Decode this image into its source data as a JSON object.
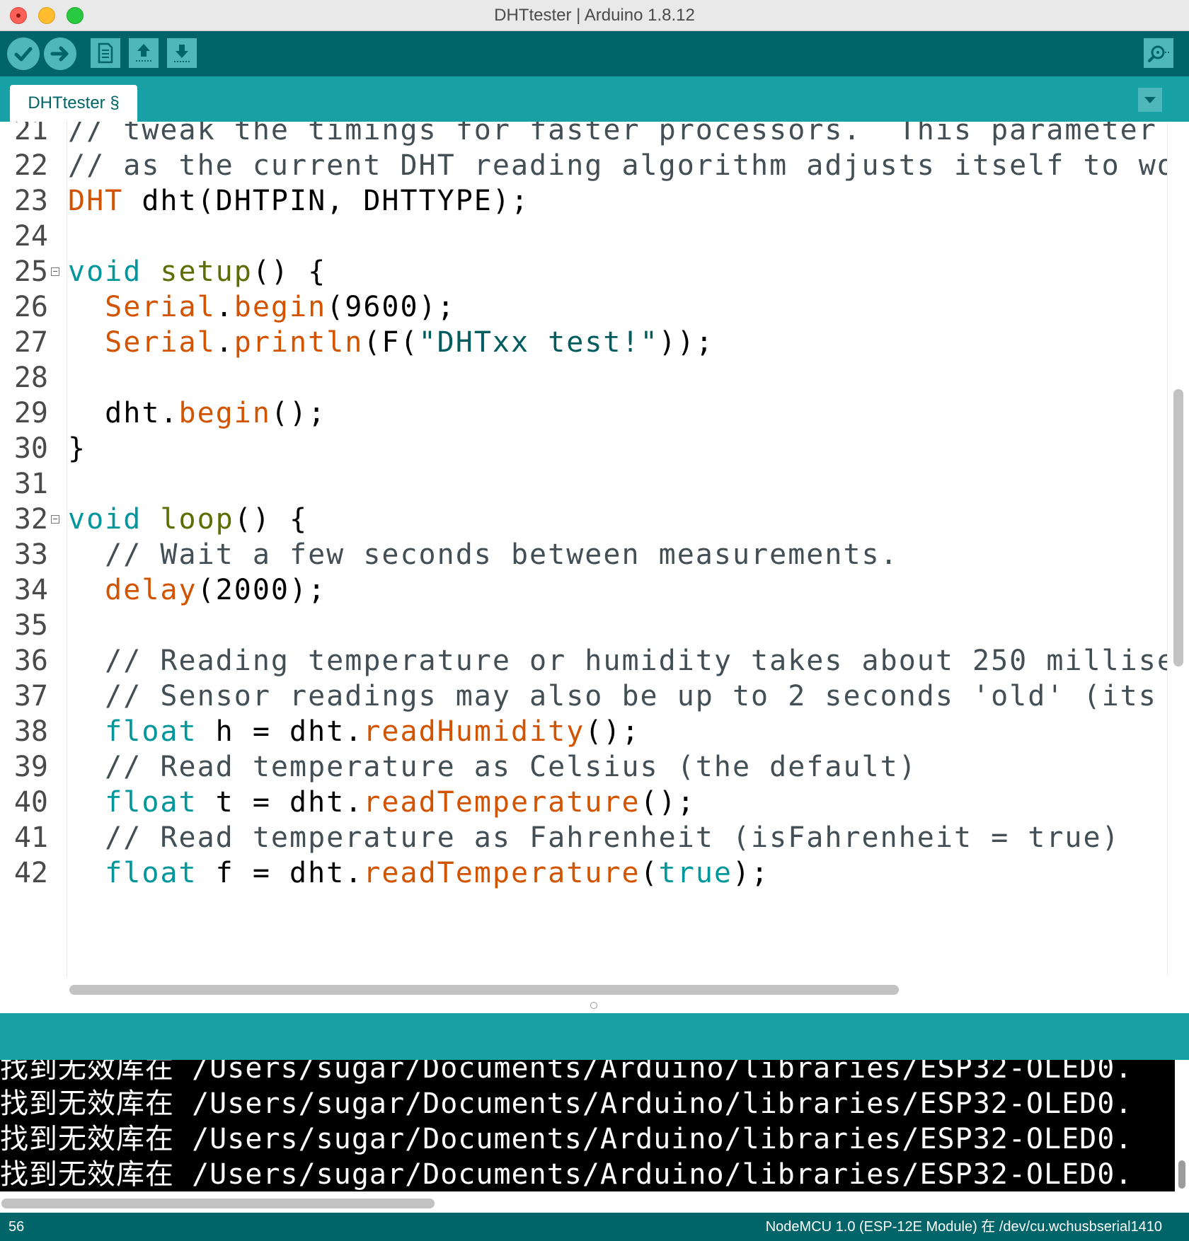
{
  "window": {
    "title": "DHTtester | Arduino 1.8.12"
  },
  "toolbar": {
    "verify": "check-icon",
    "upload": "arrow-right-icon",
    "new": "new-file-icon",
    "open": "open-upload-icon",
    "save": "save-download-icon",
    "serial_monitor": "serial-monitor-icon"
  },
  "tabs": [
    {
      "label": "DHTtester §"
    }
  ],
  "editor": {
    "lines": [
      {
        "num": "21",
        "parts": [
          {
            "t": "// tweak the timings for faster processors.  This parameter",
            "c": "cm"
          }
        ]
      },
      {
        "num": "22",
        "parts": [
          {
            "t": "// as the current DHT reading algorithm adjusts itself to wo",
            "c": "cm"
          }
        ]
      },
      {
        "num": "23",
        "parts": [
          {
            "t": "DHT",
            "c": "lib"
          },
          {
            "t": " dht(DHTPIN, DHTTYPE);",
            "c": ""
          }
        ]
      },
      {
        "num": "24",
        "parts": []
      },
      {
        "num": "25",
        "fold": true,
        "parts": [
          {
            "t": "void",
            "c": "type"
          },
          {
            "t": " ",
            "c": ""
          },
          {
            "t": "setup",
            "c": "func"
          },
          {
            "t": "() {",
            "c": ""
          }
        ]
      },
      {
        "num": "26",
        "parts": [
          {
            "t": "  ",
            "c": ""
          },
          {
            "t": "Serial",
            "c": "lib"
          },
          {
            "t": ".",
            "c": ""
          },
          {
            "t": "begin",
            "c": "lib"
          },
          {
            "t": "(9600);",
            "c": ""
          }
        ]
      },
      {
        "num": "27",
        "parts": [
          {
            "t": "  ",
            "c": ""
          },
          {
            "t": "Serial",
            "c": "lib"
          },
          {
            "t": ".",
            "c": ""
          },
          {
            "t": "println",
            "c": "lib"
          },
          {
            "t": "(F(",
            "c": ""
          },
          {
            "t": "\"DHTxx test!\"",
            "c": "str"
          },
          {
            "t": "));",
            "c": ""
          }
        ]
      },
      {
        "num": "28",
        "parts": []
      },
      {
        "num": "29",
        "parts": [
          {
            "t": "  dht.",
            "c": ""
          },
          {
            "t": "begin",
            "c": "lib"
          },
          {
            "t": "();",
            "c": ""
          }
        ]
      },
      {
        "num": "30",
        "parts": [
          {
            "t": "}",
            "c": ""
          }
        ]
      },
      {
        "num": "31",
        "parts": []
      },
      {
        "num": "32",
        "fold": true,
        "parts": [
          {
            "t": "void",
            "c": "type"
          },
          {
            "t": " ",
            "c": ""
          },
          {
            "t": "loop",
            "c": "func"
          },
          {
            "t": "() {",
            "c": ""
          }
        ]
      },
      {
        "num": "33",
        "parts": [
          {
            "t": "  // Wait a few seconds between measurements.",
            "c": "cm"
          }
        ]
      },
      {
        "num": "34",
        "parts": [
          {
            "t": "  ",
            "c": ""
          },
          {
            "t": "delay",
            "c": "lib"
          },
          {
            "t": "(2000);",
            "c": ""
          }
        ]
      },
      {
        "num": "35",
        "parts": []
      },
      {
        "num": "36",
        "parts": [
          {
            "t": "  // Reading temperature or humidity takes about 250 millise",
            "c": "cm"
          }
        ]
      },
      {
        "num": "37",
        "parts": [
          {
            "t": "  // Sensor readings may also be up to 2 seconds 'old' (its",
            "c": "cm"
          }
        ]
      },
      {
        "num": "38",
        "parts": [
          {
            "t": "  ",
            "c": ""
          },
          {
            "t": "float",
            "c": "type"
          },
          {
            "t": " h = dht.",
            "c": ""
          },
          {
            "t": "readHumidity",
            "c": "lib"
          },
          {
            "t": "();",
            "c": ""
          }
        ]
      },
      {
        "num": "39",
        "parts": [
          {
            "t": "  // Read temperature as Celsius (the default)",
            "c": "cm"
          }
        ]
      },
      {
        "num": "40",
        "parts": [
          {
            "t": "  ",
            "c": ""
          },
          {
            "t": "float",
            "c": "type"
          },
          {
            "t": " t = dht.",
            "c": ""
          },
          {
            "t": "readTemperature",
            "c": "lib"
          },
          {
            "t": "();",
            "c": ""
          }
        ]
      },
      {
        "num": "41",
        "parts": [
          {
            "t": "  // Read temperature as Fahrenheit (isFahrenheit = true)",
            "c": "cm"
          }
        ]
      },
      {
        "num": "42",
        "parts": [
          {
            "t": "  ",
            "c": ""
          },
          {
            "t": "float",
            "c": "type"
          },
          {
            "t": " f = dht.",
            "c": ""
          },
          {
            "t": "readTemperature",
            "c": "lib"
          },
          {
            "t": "(",
            "c": ""
          },
          {
            "t": "true",
            "c": "type"
          },
          {
            "t": ");",
            "c": ""
          }
        ]
      }
    ]
  },
  "console": {
    "lines": [
      "找到无效库在 /Users/sugar/Documents/Arduino/libraries/ESP32-OLED0.",
      "找到无效库在 /Users/sugar/Documents/Arduino/libraries/ESP32-OLED0.",
      "找到无效库在 /Users/sugar/Documents/Arduino/libraries/ESP32-OLED0.",
      "找到无效库在 /Users/sugar/Documents/Arduino/libraries/ESP32-OLED0."
    ]
  },
  "statusbar": {
    "line_number": "56",
    "board": "NodeMCU 1.0 (ESP-12E Module) 在 /dev/cu.wchusbserial1410"
  },
  "colors": {
    "toolbar": "#006468",
    "tabstrip": "#17a1a5",
    "button": "#4db7bb",
    "type_keyword": "#00979c",
    "function_keyword": "#5e6d03",
    "library_keyword": "#d35400",
    "comment": "#434f54"
  }
}
